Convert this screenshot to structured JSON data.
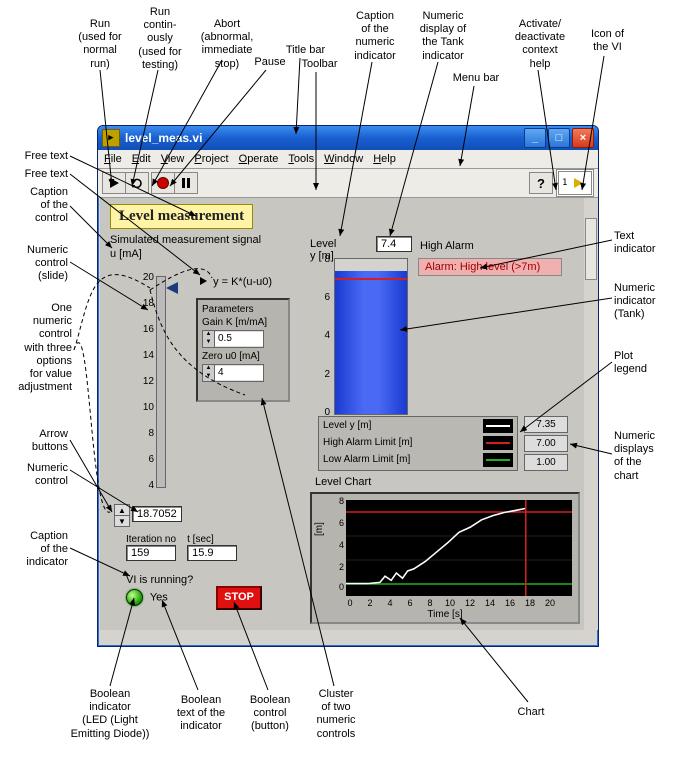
{
  "window": {
    "title": "level_meas.vi",
    "icon_glyph": "▶"
  },
  "menu": [
    "File",
    "Edit",
    "View",
    "Project",
    "Operate",
    "Tools",
    "Window",
    "Help"
  ],
  "toolbar": {
    "help_glyph": "?",
    "vi_icon_label": "1"
  },
  "panel": {
    "title": "Level measurement",
    "sim_label": "Simulated measurement signal",
    "u_label": "u [mA]",
    "formula": "y = K*(u-u0)",
    "cluster_title": "Parameters",
    "gain_label": "Gain K [m/mA]",
    "gain_value": "0.5",
    "zero_label": "Zero u0 [mA]",
    "zero_value": "4",
    "slide_value": "18.7052",
    "slide_scale": [
      "20",
      "18",
      "16",
      "14",
      "12",
      "10",
      "8",
      "6",
      "4"
    ],
    "iter_label": "Iteration no",
    "iter_value": "159",
    "t_label": "t [sec]",
    "t_value": "15.9",
    "running_label": "VI is running?",
    "running_text": "Yes",
    "stop_label": "STOP",
    "tank_caption": "Level y [m]",
    "tank_value": "7.4",
    "tank_scale": [
      "8",
      "6",
      "4",
      "2",
      "0"
    ],
    "high_alarm_caption": "High Alarm",
    "alarm_text": "Alarm: High level (>7m)",
    "legend": [
      {
        "name": "Level y [m]",
        "color": "#ffffff",
        "value": "7.35"
      },
      {
        "name": "High Alarm Limit [m]",
        "color": "#d02020",
        "value": "7.00"
      },
      {
        "name": "Low Alarm Limit [m]",
        "color": "#20b020",
        "value": "1.00"
      }
    ],
    "chart_label": "Level Chart",
    "chart_ylabel": "[m]",
    "chart_xlabel": "Time [s]",
    "chart_yticks": [
      "8",
      "6",
      "4",
      "2",
      "0"
    ],
    "chart_xticks": [
      "0",
      "2",
      "4",
      "6",
      "8",
      "10",
      "12",
      "14",
      "16",
      "18",
      "20"
    ]
  },
  "chart_data": {
    "type": "line",
    "xlabel": "Time [s]",
    "ylabel": "[m]",
    "xlim": [
      0,
      20
    ],
    "ylim": [
      0,
      8
    ],
    "series": [
      {
        "name": "Level y [m]",
        "color": "#ffffff",
        "x": [
          0,
          1,
          2,
          3,
          3.5,
          4,
          4.5,
          5,
          5.5,
          6,
          7,
          8,
          9,
          10,
          11,
          12,
          13,
          14,
          15,
          15.9
        ],
        "y": [
          1,
          1,
          1,
          1.1,
          1.6,
          1.3,
          1.9,
          1.5,
          2.1,
          2.3,
          2.9,
          3.7,
          4.5,
          5.3,
          5.8,
          6.4,
          6.7,
          7.0,
          7.2,
          7.35
        ]
      },
      {
        "name": "High Alarm Limit [m]",
        "color": "#d02020",
        "x": [
          0,
          20
        ],
        "y": [
          7,
          7
        ]
      },
      {
        "name": "Low Alarm Limit [m]",
        "color": "#20b020",
        "x": [
          0,
          20
        ],
        "y": [
          1,
          1
        ]
      }
    ],
    "cursor": {
      "x": 15.9,
      "color": "#d02020"
    }
  },
  "annotations": {
    "run": "Run\n(used for\nnormal\nrun)",
    "run_cont": "Run\ncontin-\nously\n(used for\ntesting)",
    "abort": "Abort\n(abnormal,\nimmediate\nstop)",
    "pause": "Pause",
    "titlebar": "Title bar",
    "toolbar": "Toolbar",
    "caption_num": "Caption\nof the\nnumeric\nindicator",
    "num_tank": "Numeric\ndisplay of\nthe Tank\nindicator",
    "menubar": "Menu bar",
    "ctx_help": "Activate/\ndeactivate\ncontext\nhelp",
    "vi_icon": "Icon of\nthe VI",
    "free1": "Free text",
    "free2": "Free text",
    "cap_ctrl": "Caption\nof the\ncontrol",
    "slide": "Numeric\ncontrol\n(slide)",
    "three_opts": "One\nnumeric\ncontrol\nwith three\noptions\nfor value\nadjustment",
    "arrow_btn": "Arrow\nbuttons",
    "num_ctrl": "Numeric\ncontrol",
    "cap_ind": "Caption\nof the\nindicator",
    "bool_led": "Boolean\nindicator\n(LED (Light\nEmitting Diode))",
    "bool_txt": "Boolean\ntext of the\nindicator",
    "bool_btn": "Boolean\ncontrol\n(button)",
    "cluster": "Cluster\nof two\nnumeric\ncontrols",
    "chart": "Chart",
    "text_ind": "Text\nindicator",
    "tank_ind": "Numeric\nindicator\n(Tank)",
    "legend": "Plot\nlegend",
    "num_chart": "Numeric\ndisplays\nof the\nchart"
  }
}
